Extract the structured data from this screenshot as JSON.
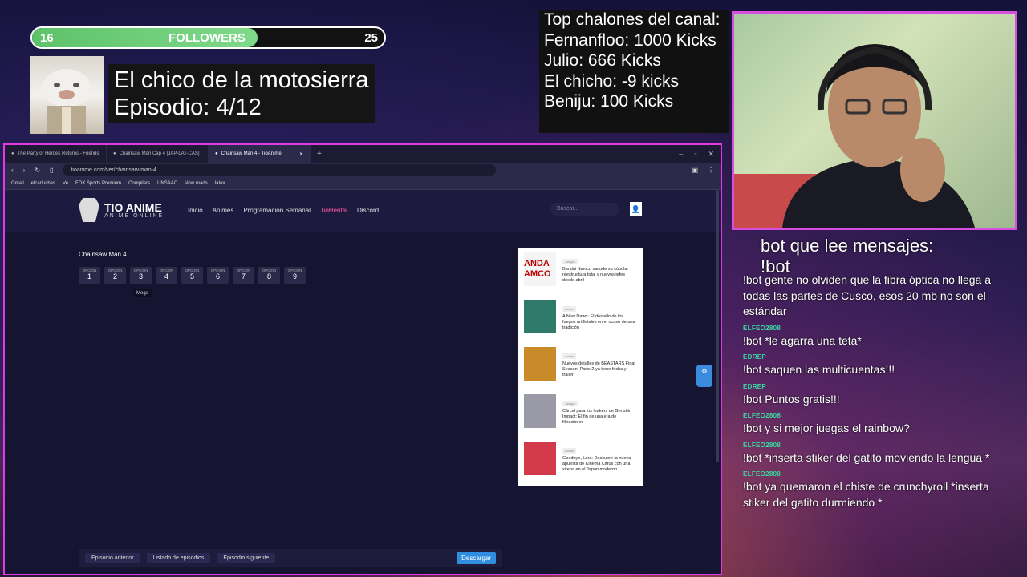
{
  "followers": {
    "current": "16",
    "label": "FOLLOWERS",
    "goal": "25",
    "progress": 0.64
  },
  "anime": {
    "title": "El chico de la motosierra",
    "episode": "Episodio: 4/12"
  },
  "top": {
    "heading": "Top chalones del canal:",
    "entries": [
      "Fernanfloo: 1000 Kicks",
      "Julio: 666 Kicks",
      "El chicho: -9 kicks",
      "Beniju: 100 Kicks"
    ]
  },
  "bot_note": {
    "line1": "bot que lee mensajes:",
    "line2": "!bot"
  },
  "chat": [
    {
      "user": "",
      "text": "!bot gente no olviden que la fibra óptica no llega a todas las partes de Cusco, esos 20 mb no son el estándar",
      "color": "#ffffff"
    },
    {
      "user": "ELFEO2808",
      "text": "!bot *le agarra una teta*",
      "color": "#3ad8a0"
    },
    {
      "user": "EDREP",
      "text": "!bot saquen las multicuentas!!!",
      "color": "#3ad8a0"
    },
    {
      "user": "EDREP",
      "text": "!bot Puntos gratis!!!",
      "color": "#3ad8a0"
    },
    {
      "user": "ELFEO2808",
      "text": "!bot y si mejor juegas el rainbow?",
      "color": "#3ad8a0"
    },
    {
      "user": "ELFEO2808",
      "text": "!bot *inserta stiker del gatito moviendo la lengua *",
      "color": "#3ad8a0"
    },
    {
      "user": "ELFEO2808",
      "text": "!bot ya quemaron el chiste de crunchyroll *inserta stiker del gatito durmiendo *",
      "color": "#3ad8a0"
    }
  ],
  "browser": {
    "tabs": [
      {
        "label": "The Party of Heroes Returns - Friends"
      },
      {
        "label": "Chainsaw Man Cap 4 [JAP-LAT-CAS]"
      },
      {
        "label": "Chainsaw Man 4 - TioAnime",
        "active": true
      }
    ],
    "url": "tioanime.com/ver/chainsaw-man-4",
    "bookmarks": [
      "Gmail",
      "elcarluchas",
      "Ve",
      "FOX Sports Premium",
      "Compilers",
      "UNSAAC",
      "slow roads",
      "latex"
    ]
  },
  "site": {
    "logo_title": "TIO ANIME",
    "logo_sub": "ANIME ONLINE",
    "nav": [
      "Inicio",
      "Animes",
      "Programación Semanal",
      "TioHentai",
      "Discord"
    ],
    "search_placeholder": "Buscar...",
    "episode_title": "Chainsaw Man 4",
    "option_label": "OPCION",
    "options": [
      "1",
      "2",
      "3",
      "4",
      "5",
      "6",
      "7",
      "8",
      "9"
    ],
    "tooltip": "Mega",
    "news": [
      {
        "tag": "Juegos",
        "title": "Bandai Namco sacude su cúpula: reestructura total y nuevos jefes desde abril",
        "thumb_text": "ANDA AMCO"
      },
      {
        "tag": "Anime",
        "title": "A New Dawn: El destello de los fuegos artificiales en el ocaso de una tradición",
        "thumb_text": ""
      },
      {
        "tag": "Anime",
        "title": "Nuevos detalles de BEASTARS Final Season: Parte 2 ya tiene fecha y tráiler",
        "thumb_text": ""
      },
      {
        "tag": "Juegos",
        "title": "Cárcel para los leakers de Genshin Impact: El fin de una era de filtraciones",
        "thumb_text": ""
      },
      {
        "tag": "Anime",
        "title": "Goodbye, Lara: Descubre la nueva apuesta de Kinema Citrus con una sirena en el Japón moderno",
        "thumb_text": ""
      }
    ],
    "prev_episode": "Episodio anterior",
    "episode_list": "Listado de episodios",
    "next_episode": "Episodio siguiente",
    "download": "Descargar"
  }
}
